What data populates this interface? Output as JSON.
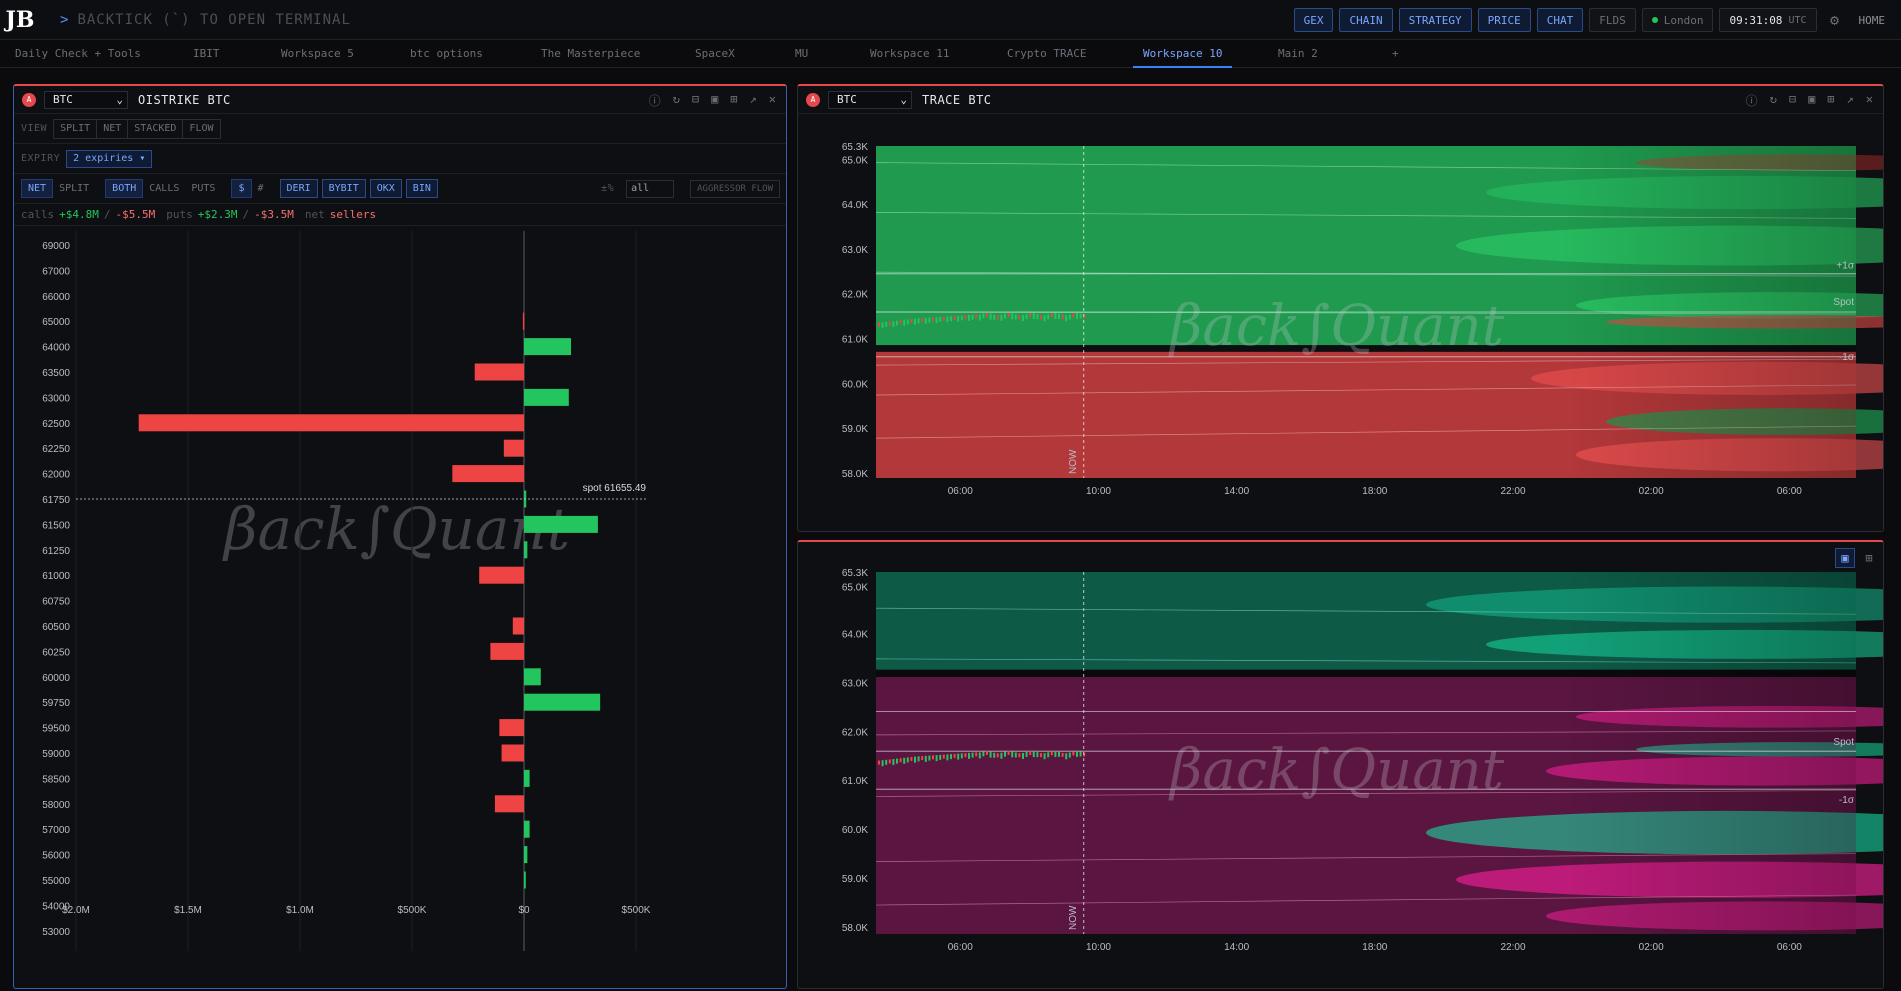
{
  "topbar": {
    "logo": "JB",
    "prompt_arrow": ">",
    "prompt": "BACKTICK (`) TO OPEN TERMINAL",
    "nav": [
      "GEX",
      "CHAIN",
      "STRATEGY",
      "PRICE",
      "CHAT"
    ],
    "flds": "FLDS",
    "location": "London",
    "time": "09:31:08",
    "tz": "UTC",
    "home": "HOME"
  },
  "tabs": [
    "Daily Check + Tools",
    "IBIT",
    "Workspace 5",
    "btc options",
    "The Masterpiece",
    "SpaceX",
    "MU",
    "Workspace 11",
    "Crypto TRACE",
    "Workspace 10",
    "Main 2",
    "+"
  ],
  "active_tab": "Workspace 10",
  "colors": {
    "accent": "#3b82f6",
    "positive": "#22c55e",
    "negative": "#ef4444",
    "panel_border": "#e5484d"
  },
  "oistrike": {
    "asset": "BTC",
    "title": "OISTRIKE BTC",
    "view_label": "VIEW",
    "view_options": [
      "SPLIT",
      "NET",
      "STACKED",
      "FLOW"
    ],
    "expiry_label": "EXPIRY",
    "expiry_value": "2 expiries ▾",
    "mode": [
      "NET",
      "SPLIT"
    ],
    "side": [
      "BOTH",
      "CALLS",
      "PUTS"
    ],
    "unit": [
      "$",
      "#"
    ],
    "exchanges": [
      "DERI",
      "BYBIT",
      "OKX",
      "BIN"
    ],
    "pct_label": "±%",
    "pct_value": "all",
    "aggressor": "AGGRESSOR FLOW",
    "calls_label": "calls",
    "calls_pos": "+$4.8M",
    "calls_neg": "-$5.5M",
    "puts_label": "puts",
    "puts_pos": "+$2.3M",
    "puts_neg": "-$3.5M",
    "net_label": "net",
    "net_value": "sellers",
    "slash": "/",
    "spot_label": "spot 61655.49",
    "watermark": "βack∫Quant"
  },
  "chart_data": [
    {
      "type": "bar",
      "orientation": "horizontal",
      "categories": [
        "69000",
        "67000",
        "66000",
        "65000",
        "64000",
        "63500",
        "63000",
        "62500",
        "62250",
        "62000",
        "61750",
        "61500",
        "61250",
        "61000",
        "60750",
        "60500",
        "60250",
        "60000",
        "59750",
        "59500",
        "59000",
        "58500",
        "58000",
        "57000",
        "56000",
        "55000",
        "54000",
        "53000"
      ],
      "values": [
        0,
        0,
        0,
        -5000,
        210000,
        -220000,
        200000,
        -1720000,
        -90000,
        -320000,
        10000,
        330000,
        15000,
        -200000,
        0,
        -50000,
        -150000,
        75000,
        340000,
        -110000,
        -100000,
        25000,
        -130000,
        25000,
        15000,
        8000,
        0,
        0
      ],
      "xlim": [
        -2000000,
        500000
      ],
      "x_ticks": [
        "$2.0M",
        "$1.5M",
        "$1.0M",
        "$500K",
        "$0",
        "$500K"
      ],
      "spot": 61655.49
    },
    {
      "type": "heatmap",
      "asset": "BTC",
      "title": "TRACE BTC",
      "y_ticks": [
        "65.3K",
        "65.0K",
        "64.0K",
        "63.0K",
        "62.0K",
        "61.0K",
        "60.0K",
        "59.0K",
        "58.0K"
      ],
      "x_ticks": [
        "06:00",
        "10:00",
        "14:00",
        "18:00",
        "22:00",
        "02:00",
        "06:00"
      ],
      "now_label": "NOW",
      "level_labels": [
        "+1σ",
        "Spot",
        "-1σ"
      ]
    },
    {
      "type": "heatmap",
      "y_ticks": [
        "65.3K",
        "65.0K",
        "64.0K",
        "63.0K",
        "62.0K",
        "61.0K",
        "60.0K",
        "59.0K",
        "58.0K"
      ],
      "x_ticks": [
        "06:00",
        "10:00",
        "14:00",
        "18:00",
        "22:00",
        "02:00",
        "06:00"
      ],
      "now_label": "NOW",
      "level_labels": [
        "Spot",
        "-1σ"
      ]
    }
  ]
}
